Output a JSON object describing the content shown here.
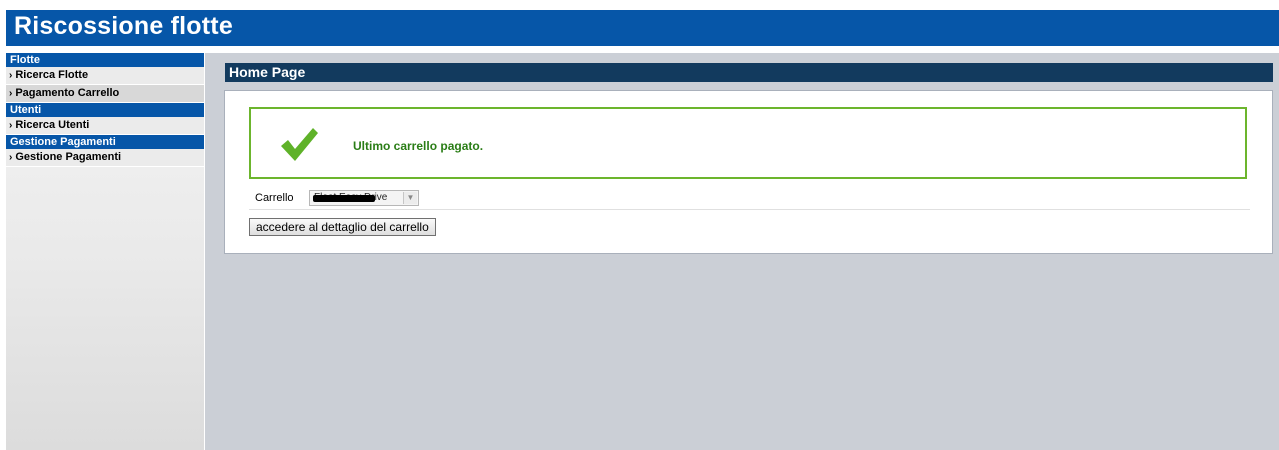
{
  "app": {
    "title": "Riscossione flotte"
  },
  "sidebar": {
    "groups": [
      {
        "header": "Flotte",
        "items": [
          {
            "label": "Ricerca Flotte"
          },
          {
            "label": "Pagamento Carrello"
          }
        ]
      },
      {
        "header": "Utenti",
        "items": [
          {
            "label": "Ricerca Utenti"
          }
        ]
      },
      {
        "header": "Gestione Pagamenti",
        "items": [
          {
            "label": "Gestione Pagamenti"
          }
        ]
      }
    ],
    "chevron": "›"
  },
  "main": {
    "page_title": "Home Page",
    "success_message": "Ultimo carrello pagato.",
    "cart": {
      "label": "Carrello",
      "selected_value": "Fleet Easy Drive"
    },
    "detail_button": "accedere al dettaglio del carrello"
  },
  "colors": {
    "brand": "#0656a8",
    "page_header": "#123a5e",
    "success": "#6cb52d"
  },
  "icons": {
    "success": "checkmark-icon",
    "select_arrow": "chevron-down-icon"
  }
}
